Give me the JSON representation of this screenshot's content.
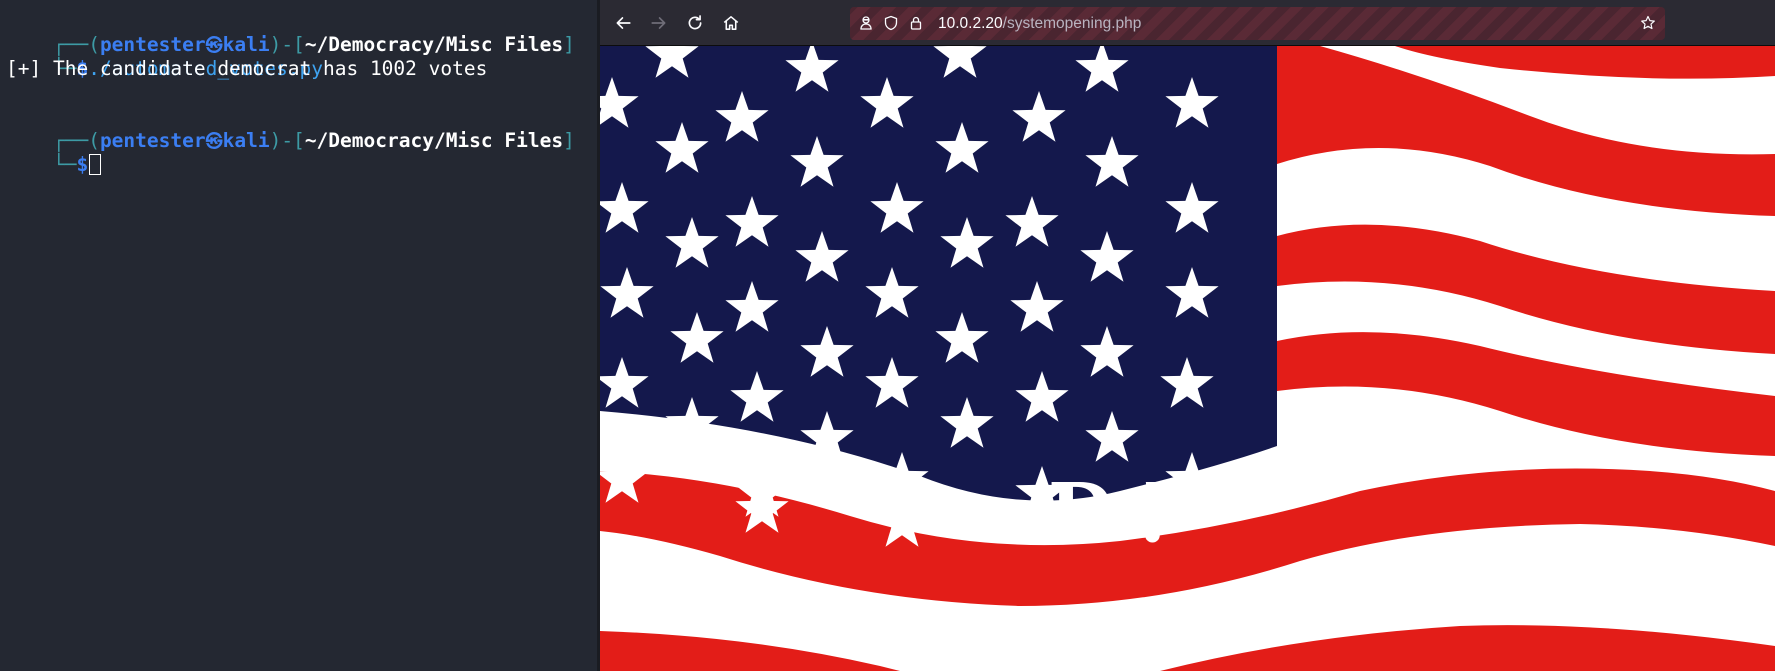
{
  "terminal": {
    "frame_top": "┌──(",
    "frame_bottom": "└─",
    "user": "pentester",
    "skull": "㉿",
    "host": "kali",
    "mid": ")-[",
    "path": "~/Democracy/Misc Files",
    "close": "]",
    "dollar": "$",
    "command": "./automated_votes.py",
    "output": "[+] The candidate democrat has 1002 votes"
  },
  "browser": {
    "url_host": "10.0.2.20",
    "url_path": "/systemopening.php",
    "icons": [
      "back-arrow-icon",
      "forward-arrow-icon",
      "reload-icon",
      "home-icon",
      "spy-icon",
      "shield-icon",
      "lock-icon",
      "star-icon"
    ]
  },
  "page": {
    "image": "us-flag",
    "colors": {
      "blue": "#14184c",
      "red": "#e31d18",
      "white": "#ffffff"
    }
  }
}
